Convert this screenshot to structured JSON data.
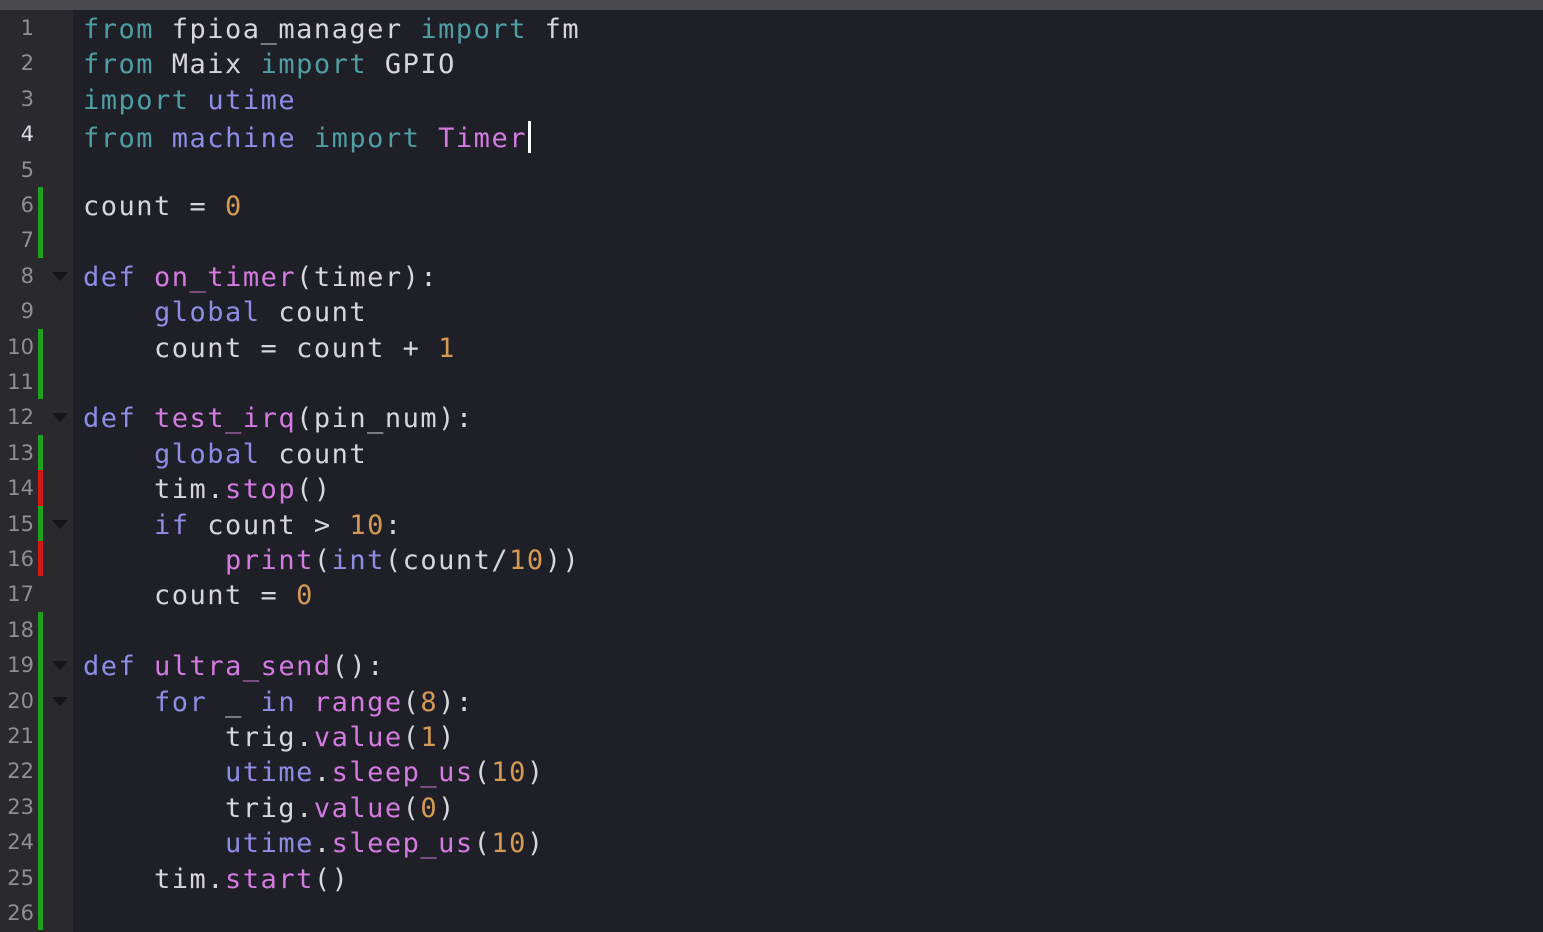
{
  "editor": {
    "theme_colors": {
      "background": "#1f1f27",
      "gutter": "#2a2a2e",
      "keyword": "#4e9ea3",
      "def_keyword": "#8f8ce6",
      "number": "#d49a55",
      "function": "#d37be0",
      "added_marker": "#20a020",
      "changed_marker": "#d01818"
    },
    "current_line": 4,
    "lines": [
      {
        "n": "1",
        "marker": "none",
        "fold": false,
        "tokens": [
          [
            "kw",
            "from"
          ],
          [
            "text",
            " fpioa_manager "
          ],
          [
            "kw",
            "import"
          ],
          [
            "text",
            " fm"
          ]
        ]
      },
      {
        "n": "2",
        "marker": "none",
        "fold": false,
        "tokens": [
          [
            "kw",
            "from"
          ],
          [
            "text",
            " Maix "
          ],
          [
            "kw",
            "import"
          ],
          [
            "text",
            " GPIO"
          ]
        ]
      },
      {
        "n": "3",
        "marker": "none",
        "fold": false,
        "tokens": [
          [
            "kw",
            "import"
          ],
          [
            "text",
            " "
          ],
          [
            "mod",
            "utime"
          ]
        ]
      },
      {
        "n": "4",
        "marker": "none",
        "fold": false,
        "tokens": [
          [
            "kw",
            "from"
          ],
          [
            "text",
            " "
          ],
          [
            "mod",
            "machine"
          ],
          [
            "text",
            " "
          ],
          [
            "kw",
            "import"
          ],
          [
            "text",
            " "
          ],
          [
            "cls",
            "Timer"
          ]
        ],
        "cursor": true
      },
      {
        "n": "5",
        "marker": "none",
        "fold": false,
        "tokens": []
      },
      {
        "n": "6",
        "marker": "added",
        "fold": false,
        "tokens": [
          [
            "text",
            "count = "
          ],
          [
            "num",
            "0"
          ]
        ]
      },
      {
        "n": "7",
        "marker": "added",
        "fold": false,
        "tokens": []
      },
      {
        "n": "8",
        "marker": "none",
        "fold": true,
        "tokens": [
          [
            "def",
            "def"
          ],
          [
            "text",
            " "
          ],
          [
            "func",
            "on_timer"
          ],
          [
            "text",
            "(timer):"
          ]
        ]
      },
      {
        "n": "9",
        "marker": "none",
        "fold": false,
        "tokens": [
          [
            "text",
            "    "
          ],
          [
            "def",
            "global"
          ],
          [
            "text",
            " count"
          ]
        ]
      },
      {
        "n": "10",
        "marker": "added",
        "fold": false,
        "tokens": [
          [
            "text",
            "    count = count + "
          ],
          [
            "num",
            "1"
          ]
        ]
      },
      {
        "n": "11",
        "marker": "added",
        "fold": false,
        "tokens": []
      },
      {
        "n": "12",
        "marker": "none",
        "fold": true,
        "tokens": [
          [
            "def",
            "def"
          ],
          [
            "text",
            " "
          ],
          [
            "func",
            "test_irq"
          ],
          [
            "text",
            "(pin_num):"
          ]
        ]
      },
      {
        "n": "13",
        "marker": "added",
        "fold": false,
        "tokens": [
          [
            "text",
            "    "
          ],
          [
            "def",
            "global"
          ],
          [
            "text",
            " count"
          ]
        ]
      },
      {
        "n": "14",
        "marker": "changed",
        "fold": false,
        "tokens": [
          [
            "text",
            "    tim."
          ],
          [
            "func",
            "stop"
          ],
          [
            "text",
            "()"
          ]
        ]
      },
      {
        "n": "15",
        "marker": "added",
        "fold": true,
        "tokens": [
          [
            "text",
            "    "
          ],
          [
            "def",
            "if"
          ],
          [
            "text",
            " count > "
          ],
          [
            "num",
            "10"
          ],
          [
            "text",
            ":"
          ]
        ]
      },
      {
        "n": "16",
        "marker": "changed",
        "fold": false,
        "tokens": [
          [
            "text",
            "        "
          ],
          [
            "func",
            "print"
          ],
          [
            "text",
            "("
          ],
          [
            "def",
            "int"
          ],
          [
            "text",
            "(count/"
          ],
          [
            "num",
            "10"
          ],
          [
            "text",
            "))"
          ]
        ]
      },
      {
        "n": "17",
        "marker": "none",
        "fold": false,
        "tokens": [
          [
            "text",
            "    count = "
          ],
          [
            "num",
            "0"
          ]
        ]
      },
      {
        "n": "18",
        "marker": "added",
        "fold": false,
        "tokens": []
      },
      {
        "n": "19",
        "marker": "added",
        "fold": true,
        "tokens": [
          [
            "def",
            "def"
          ],
          [
            "text",
            " "
          ],
          [
            "func",
            "ultra_send"
          ],
          [
            "text",
            "():"
          ]
        ]
      },
      {
        "n": "20",
        "marker": "added",
        "fold": true,
        "tokens": [
          [
            "text",
            "    "
          ],
          [
            "def",
            "for"
          ],
          [
            "text",
            " _ "
          ],
          [
            "def",
            "in"
          ],
          [
            "text",
            " "
          ],
          [
            "func",
            "range"
          ],
          [
            "text",
            "("
          ],
          [
            "num",
            "8"
          ],
          [
            "text",
            "):"
          ]
        ]
      },
      {
        "n": "21",
        "marker": "added",
        "fold": false,
        "tokens": [
          [
            "text",
            "        trig."
          ],
          [
            "func",
            "value"
          ],
          [
            "text",
            "("
          ],
          [
            "num",
            "1"
          ],
          [
            "text",
            ")"
          ]
        ]
      },
      {
        "n": "22",
        "marker": "added",
        "fold": false,
        "tokens": [
          [
            "text",
            "        "
          ],
          [
            "mod",
            "utime"
          ],
          [
            "text",
            "."
          ],
          [
            "func",
            "sleep_us"
          ],
          [
            "text",
            "("
          ],
          [
            "num",
            "10"
          ],
          [
            "text",
            ")"
          ]
        ]
      },
      {
        "n": "23",
        "marker": "added",
        "fold": false,
        "tokens": [
          [
            "text",
            "        trig."
          ],
          [
            "func",
            "value"
          ],
          [
            "text",
            "("
          ],
          [
            "num",
            "0"
          ],
          [
            "text",
            ")"
          ]
        ]
      },
      {
        "n": "24",
        "marker": "added",
        "fold": false,
        "tokens": [
          [
            "text",
            "        "
          ],
          [
            "mod",
            "utime"
          ],
          [
            "text",
            "."
          ],
          [
            "func",
            "sleep_us"
          ],
          [
            "text",
            "("
          ],
          [
            "num",
            "10"
          ],
          [
            "text",
            ")"
          ]
        ]
      },
      {
        "n": "25",
        "marker": "added",
        "fold": false,
        "tokens": [
          [
            "text",
            "    tim."
          ],
          [
            "func",
            "start"
          ],
          [
            "text",
            "()"
          ]
        ]
      },
      {
        "n": "26",
        "marker": "added",
        "fold": false,
        "tokens": []
      }
    ]
  }
}
